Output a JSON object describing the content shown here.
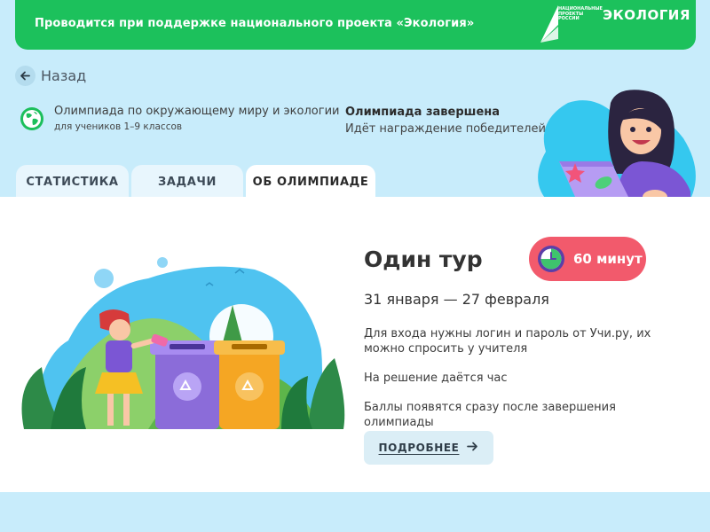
{
  "banner": {
    "text": "Проводится при поддержке национального проекта «Экология»",
    "logo_lines": [
      "НАЦИОНАЛЬНЫЕ",
      "ПРОЕКТЫ",
      "РОССИИ"
    ],
    "logo_word": "ЭКОЛОГИЯ"
  },
  "nav": {
    "back_label": "Назад",
    "back_icon": "arrow-left-icon"
  },
  "olympiad": {
    "icon": "globe-icon",
    "subject": "Олимпиада по окружающему миру и экологии",
    "grades": "для учеников 1–9 классов",
    "status_title": "Олимпиада завершена",
    "status_text": "Идёт награждение победителей"
  },
  "tabs": [
    {
      "label": "СТАТИСТИКА",
      "active": false
    },
    {
      "label": "ЗАДАЧИ",
      "active": false
    },
    {
      "label": "ОБ ОЛИМПИАДЕ",
      "active": true
    }
  ],
  "tour": {
    "title": "Один тур",
    "duration": "60 минут",
    "dates": "31 января — 27 февраля",
    "info": [
      "Для входа нужны логин и пароль от Учи.ру, их можно спросить у учителя",
      "На решение даётся час",
      "Баллы появятся сразу после завершения олимпиады"
    ],
    "more_label": "ПОДРОБНЕЕ"
  },
  "colors": {
    "page_bg": "#c8ecfb",
    "banner_green": "#1cc15c",
    "tab_inactive": "#e8f6fd",
    "time_badge": "#f25a6c",
    "button_bg": "#dbeef6"
  }
}
